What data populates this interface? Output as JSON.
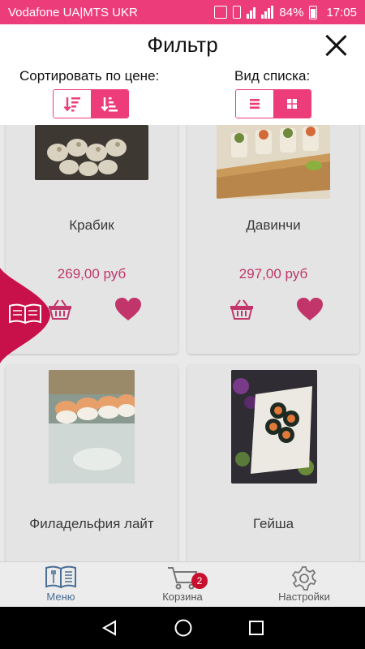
{
  "status_bar": {
    "carrier": "Vodafone UA|MTS UKR",
    "battery": "84%",
    "time": "17:05"
  },
  "filter": {
    "title": "Фильтр",
    "sort_label": "Сортировать по цене:",
    "view_label": "Вид списка:"
  },
  "products": [
    {
      "name": "Крабик",
      "price": "269,00 руб"
    },
    {
      "name": "Давинчи",
      "price": "297,00 руб"
    },
    {
      "name": "Филадельфия лайт"
    },
    {
      "name": "Гейша"
    }
  ],
  "bottom_nav": {
    "items": [
      {
        "label": "Меню"
      },
      {
        "label": "Корзина"
      },
      {
        "label": "Настройки"
      }
    ],
    "cart_badge": "2"
  },
  "colors": {
    "accent": "#ec3d7a",
    "price": "#c2356a",
    "badge": "#c8102e",
    "nav_active": "#4a6f96"
  },
  "icons": {
    "sort_buttons": [
      "sort-descending-icon",
      "sort-ascending-icon"
    ],
    "view_buttons": [
      "list-view-icon",
      "grid-view-icon"
    ],
    "side_tab": "book-icon",
    "card_actions": [
      "basket-icon",
      "heart-icon"
    ],
    "bottom_nav": [
      "menu-book-icon",
      "cart-icon",
      "gear-icon"
    ],
    "system": [
      "back-icon",
      "home-icon",
      "recents-icon"
    ]
  }
}
